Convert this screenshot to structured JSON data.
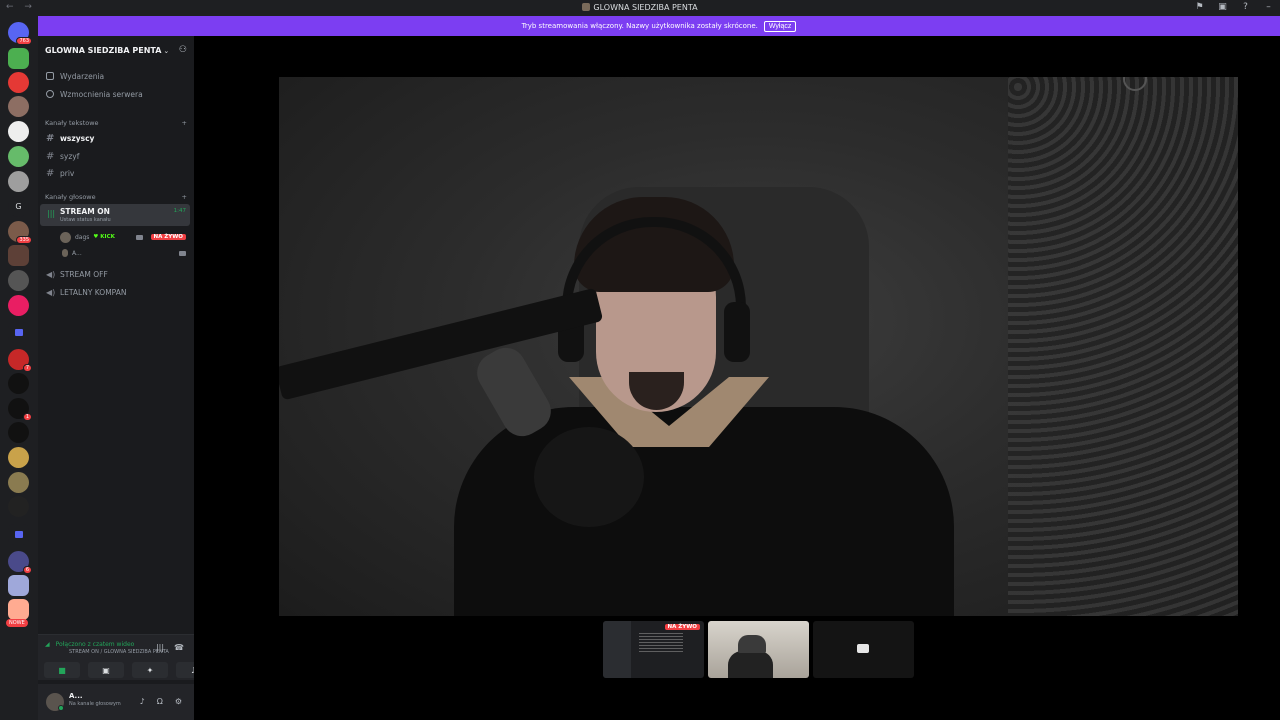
{
  "titlebar": {
    "title": "GLOWNA SIEDZIBA PENTA"
  },
  "banner": {
    "message": "Tryb streamowania włączony. Nazwy użytkownika zostały skrócone.",
    "button": "Wyłącz"
  },
  "rail": {
    "badges": [
      "763",
      "335",
      "7",
      "1",
      "6"
    ],
    "home_letter": "G",
    "new_label": "NOWE"
  },
  "server": {
    "name": "GLOWNA SIEDZIBA PENTA",
    "menu": [
      {
        "label": "Wydarzenia",
        "icon": "calendar-icon"
      },
      {
        "label": "Wzmocnienia serwera",
        "icon": "boost-icon"
      }
    ],
    "text_category": "Kanały tekstowe",
    "text_channels": [
      {
        "label": "wszyscy",
        "active": true
      },
      {
        "label": "syzyf",
        "active": false
      },
      {
        "label": "priv",
        "active": false
      }
    ],
    "voice_category": "Kanały głosowe",
    "voice_active": {
      "name": "STREAM ON",
      "status": "Ustaw status kanału",
      "time": "1:47"
    },
    "voice_users": [
      {
        "name": "dags",
        "tag": "KICK",
        "live": "NA ŻYWO"
      },
      {
        "name": "A..."
      }
    ],
    "voice_channels": [
      {
        "label": "STREAM OFF"
      },
      {
        "label": "LETALNY KOMPAN"
      }
    ]
  },
  "connection": {
    "status": "Połączono z czatem wideo",
    "location": "STREAM ON / GLOWNA SIEDZIBA PENTA"
  },
  "user": {
    "name": "A...",
    "status": "Na kanale głosowym"
  },
  "stage": {
    "thumbnail_live": "NA ŻYWO"
  },
  "colors": {
    "banner": "#7c3ef2",
    "live": "#f23f43",
    "connected": "#23a55a",
    "kick": "#53fc18"
  }
}
